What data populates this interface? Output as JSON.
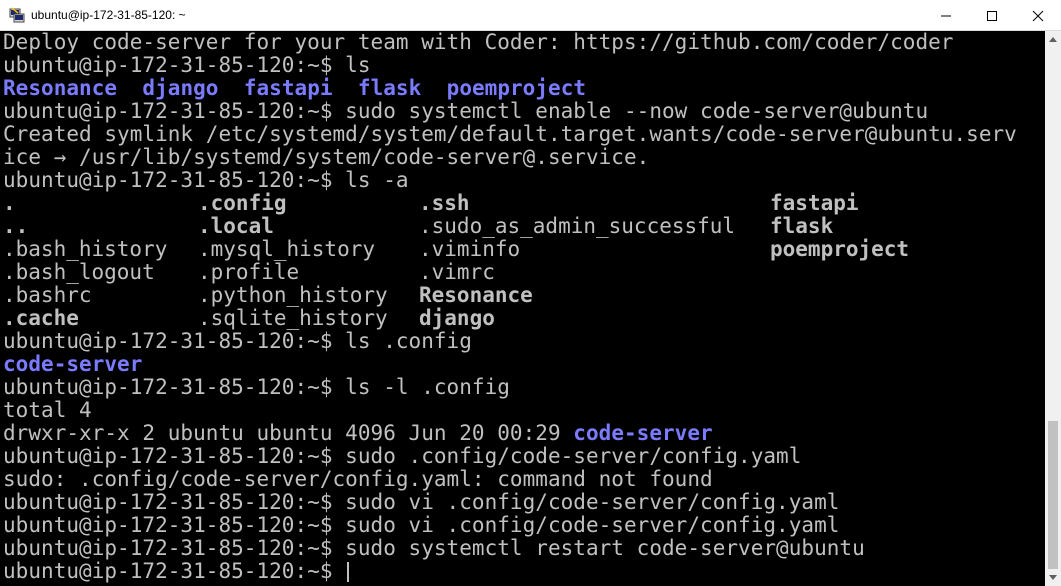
{
  "window": {
    "title": "ubuntu@ip-172-31-85-120: ~"
  },
  "terminal": {
    "prompt": "ubuntu@ip-172-31-85-120:~$",
    "lines": [
      {
        "text": "Deploy code-server for your team with Coder: https://github.com/coder/coder"
      },
      {
        "text": "ubuntu@ip-172-31-85-120:~$ ls"
      },
      {
        "text": ""
      },
      {
        "text": "ubuntu@ip-172-31-85-120:~$ sudo systemctl enable --now code-server@ubuntu"
      },
      {
        "text": "Created symlink /etc/systemd/system/default.target.wants/code-server@ubuntu.serv"
      },
      {
        "text": "ice → /usr/lib/systemd/system/code-server@.service."
      },
      {
        "text": "ubuntu@ip-172-31-85-120:~$ ls -a"
      },
      {
        "text": ""
      },
      {
        "text": ""
      },
      {
        "text": ""
      },
      {
        "text": ""
      },
      {
        "text": ""
      },
      {
        "text": ""
      },
      {
        "text": "ubuntu@ip-172-31-85-120:~$ ls .config"
      },
      {
        "text": ""
      },
      {
        "text": "ubuntu@ip-172-31-85-120:~$ ls -l .config"
      },
      {
        "text": "total 4"
      },
      {
        "text": "drwxr-xr-x 2 ubuntu ubuntu 4096 Jun 20 00:29 "
      },
      {
        "text": "ubuntu@ip-172-31-85-120:~$ sudo .config/code-server/config.yaml"
      },
      {
        "text": "sudo: .config/code-server/config.yaml: command not found"
      },
      {
        "text": "ubuntu@ip-172-31-85-120:~$ sudo vi .config/code-server/config.yaml"
      },
      {
        "text": "ubuntu@ip-172-31-85-120:~$ sudo vi .config/code-server/config.yaml"
      },
      {
        "text": "ubuntu@ip-172-31-85-120:~$ sudo systemctl restart code-server@ubuntu"
      },
      {
        "text": "ubuntu@ip-172-31-85-120:~$ "
      }
    ],
    "ls_output": [
      "Resonance",
      "django",
      "fastapi",
      "flask",
      "poemproject"
    ],
    "ls_a_output": {
      "col1": [
        ".",
        "..",
        ".bash_history",
        ".bash_logout",
        ".bashrc",
        ".cache"
      ],
      "col2": [
        ".config",
        ".local",
        ".mysql_history",
        ".profile",
        ".python_history",
        ".sqlite_history"
      ],
      "col3": [
        ".ssh",
        ".sudo_as_admin_successful",
        ".viminfo",
        ".vimrc",
        "Resonance",
        "django"
      ],
      "col4": [
        "fastapi",
        "flask",
        "poemproject",
        "",
        "",
        ""
      ]
    },
    "ls_config_output": "code-server",
    "ls_l_dir_name": "code-server"
  },
  "colors": {
    "background": "#000000",
    "text": "#c0c0c0",
    "directory": "#7b7bff"
  },
  "icons": {
    "app": "putty-icon",
    "minimize": "minimize-icon",
    "maximize": "maximize-icon",
    "close": "close-icon"
  }
}
